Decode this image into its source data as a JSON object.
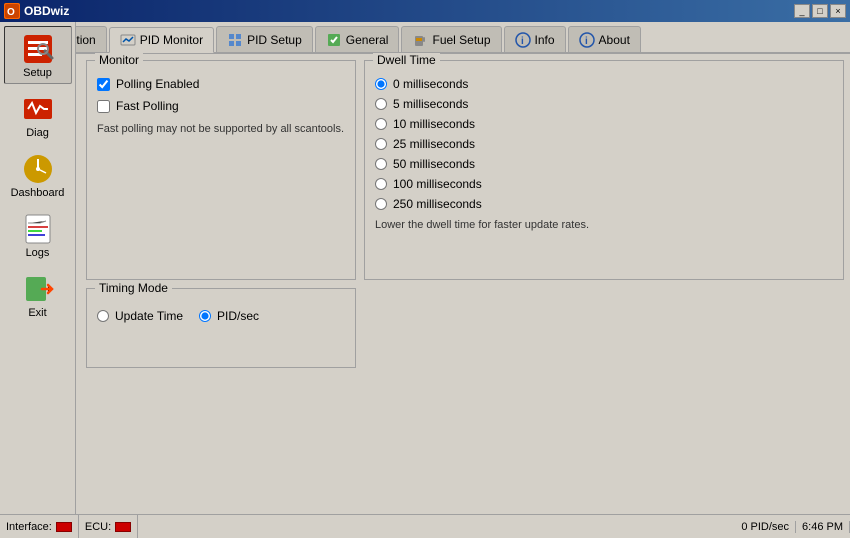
{
  "titleBar": {
    "title": "OBDwiz",
    "buttons": [
      "_",
      "□",
      "×"
    ]
  },
  "tabs": [
    {
      "id": "connection",
      "label": "Connection",
      "icon": "connection-icon"
    },
    {
      "id": "pid-monitor",
      "label": "PID Monitor",
      "icon": "pid-monitor-icon",
      "active": true
    },
    {
      "id": "pid-setup",
      "label": "PID Setup",
      "icon": "pid-setup-icon"
    },
    {
      "id": "general",
      "label": "General",
      "icon": "general-icon"
    },
    {
      "id": "fuel-setup",
      "label": "Fuel Setup",
      "icon": "fuel-setup-icon"
    },
    {
      "id": "info",
      "label": "Info",
      "icon": "info-icon"
    },
    {
      "id": "about",
      "label": "About",
      "icon": "about-icon"
    }
  ],
  "sidebar": {
    "items": [
      {
        "id": "setup",
        "label": "Setup",
        "icon": "setup-icon",
        "active": true
      },
      {
        "id": "diag",
        "label": "Diag",
        "icon": "diag-icon"
      },
      {
        "id": "dashboard",
        "label": "Dashboard",
        "icon": "dashboard-icon"
      },
      {
        "id": "logs",
        "label": "Logs",
        "icon": "logs-icon"
      },
      {
        "id": "exit",
        "label": "Exit",
        "icon": "exit-icon"
      }
    ]
  },
  "monitor": {
    "title": "Monitor",
    "pollingEnabled": true,
    "pollingEnabledLabel": "Polling Enabled",
    "fastPolling": false,
    "fastPollingLabel": "Fast Polling",
    "infoText": "Fast polling may not be supported by all scantools."
  },
  "dwellTime": {
    "title": "Dwell Time",
    "options": [
      {
        "label": "0 milliseconds",
        "value": "0",
        "selected": true
      },
      {
        "label": "5 milliseconds",
        "value": "5",
        "selected": false
      },
      {
        "label": "10 milliseconds",
        "value": "10",
        "selected": false
      },
      {
        "label": "25 milliseconds",
        "value": "25",
        "selected": false
      },
      {
        "label": "50 milliseconds",
        "value": "50",
        "selected": false
      },
      {
        "label": "100 milliseconds",
        "value": "100",
        "selected": false
      },
      {
        "label": "250 milliseconds",
        "value": "250",
        "selected": false
      }
    ],
    "hintText": "Lower the dwell time for faster update rates."
  },
  "timingMode": {
    "title": "Timing Mode",
    "options": [
      {
        "label": "Update Time",
        "value": "update",
        "selected": false
      },
      {
        "label": "PID/sec",
        "value": "pidsec",
        "selected": true
      }
    ]
  },
  "statusBar": {
    "interfaceLabel": "Interface:",
    "ecuLabel": "ECU:",
    "pidRate": "0 PID/sec",
    "time": "6:46 PM"
  }
}
